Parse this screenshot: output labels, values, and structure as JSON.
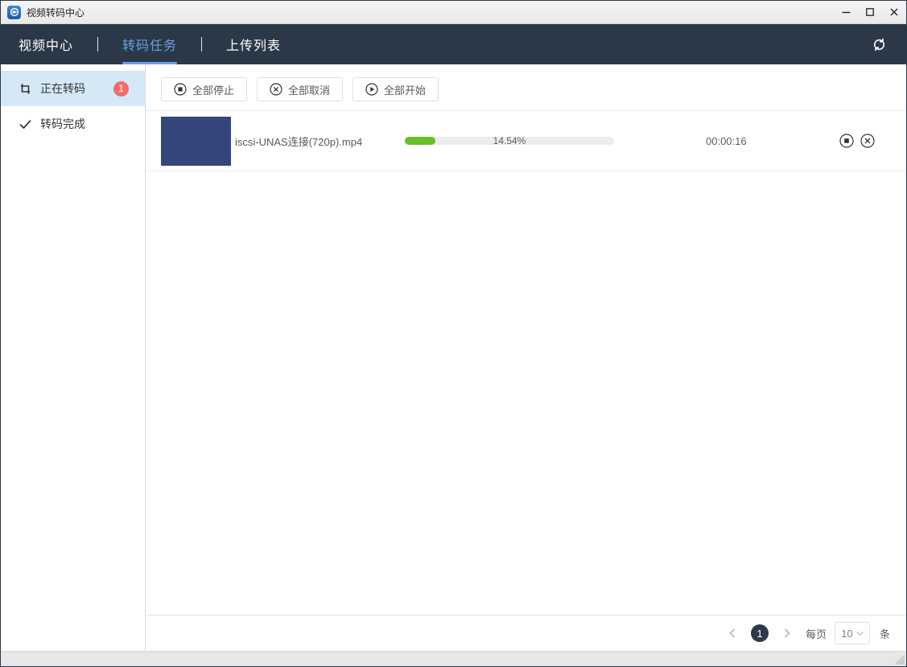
{
  "window": {
    "title": "视频转码中心"
  },
  "navbar": {
    "tabs": [
      {
        "label": "视频中心",
        "active": false
      },
      {
        "label": "转码任务",
        "active": true
      },
      {
        "label": "上传列表",
        "active": false
      }
    ]
  },
  "sidebar": {
    "items": [
      {
        "label": "正在转码",
        "icon": "transcode-crop-icon",
        "badge": "1",
        "active": true
      },
      {
        "label": "转码完成",
        "icon": "check-icon",
        "active": false
      }
    ]
  },
  "toolbar": {
    "buttons": [
      {
        "label": "全部停止",
        "icon": "stop-circle-icon"
      },
      {
        "label": "全部取消",
        "icon": "cancel-circle-icon"
      },
      {
        "label": "全部开始",
        "icon": "play-circle-icon"
      }
    ]
  },
  "tasks": [
    {
      "filename": "iscsi-UNAS连接(720p).mp4",
      "progress_percent": 14.54,
      "progress_label": "14.54%",
      "elapsed": "00:00:16"
    }
  ],
  "pagination": {
    "current_page": "1",
    "per_page_label": "每页",
    "page_size": "10",
    "unit_label": "条"
  },
  "icons": {
    "titlebar": [
      "app-logo-icon",
      "minimize-icon",
      "maximize-icon",
      "close-icon"
    ],
    "navbar": [
      "refresh-icon"
    ],
    "row_actions": [
      "stop-circle-icon",
      "cancel-circle-icon"
    ],
    "pagination": [
      "chevron-left-icon",
      "chevron-right-icon",
      "chevron-down-icon"
    ]
  },
  "colors": {
    "navbar_bg": "#2b3847",
    "tab_active": "#6d9ee8",
    "sidebar_active_bg": "#d4e8f6",
    "badge": "#f56c6c",
    "progress_fill": "#66bf2b",
    "thumbnail": "#35467b",
    "page_circle": "#2d3a4c"
  }
}
